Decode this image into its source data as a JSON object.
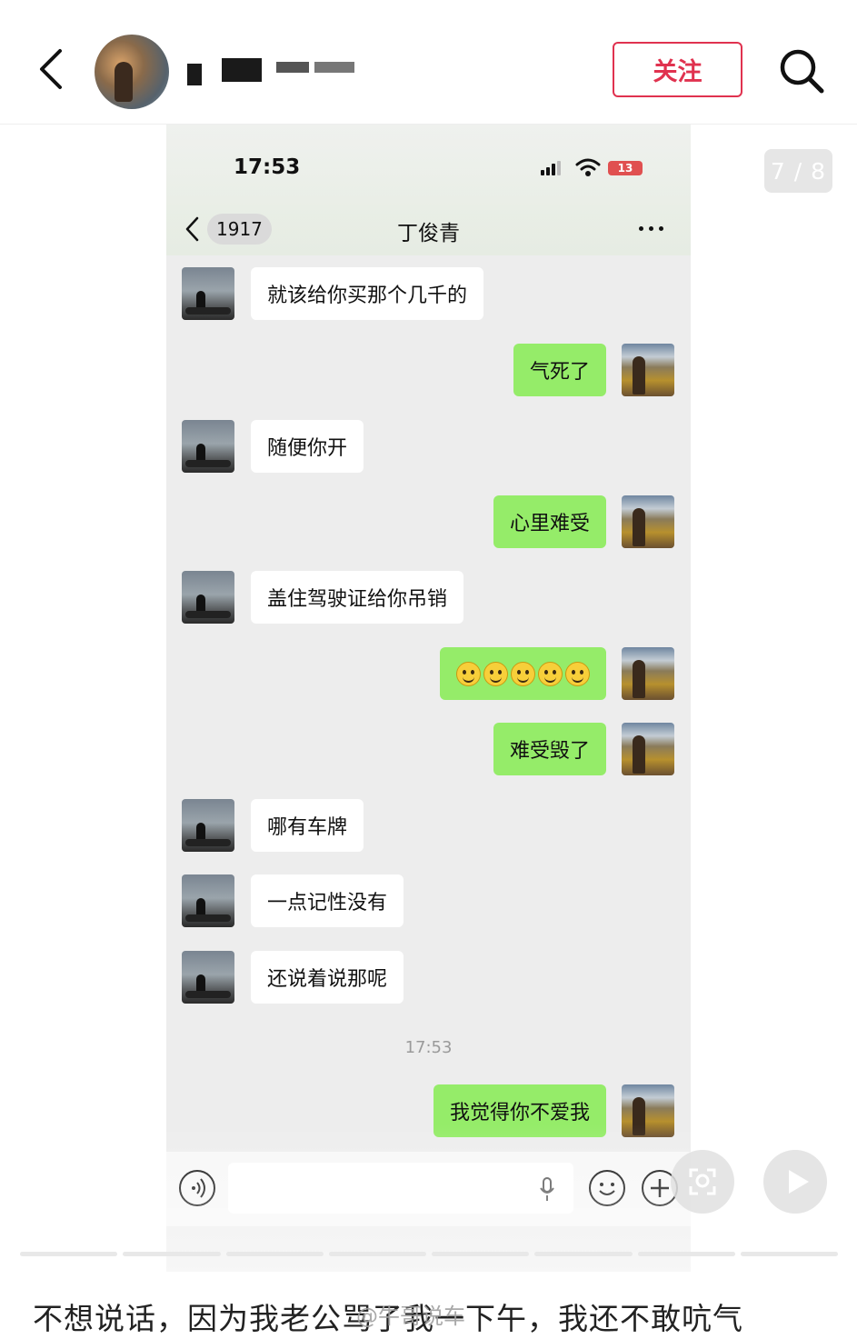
{
  "header": {
    "follow_label": "关注",
    "author_name": ""
  },
  "gallery": {
    "page_counter": "7 / 8",
    "page_current": 7,
    "page_total": 8
  },
  "phone": {
    "status": {
      "time": "17:53",
      "battery": "13"
    },
    "chat": {
      "unread_count": "1917",
      "contact_name": "丁俊青"
    },
    "messages": [
      {
        "from": "other",
        "text": "就该给你买那个几千的"
      },
      {
        "from": "me",
        "text": "气死了"
      },
      {
        "from": "other",
        "text": "随便你开"
      },
      {
        "from": "me",
        "text": "心里难受"
      },
      {
        "from": "other",
        "text": "盖住驾驶证给你吊销"
      },
      {
        "from": "me",
        "text": "",
        "emoji": "smiley-face",
        "emoji_count": 5
      },
      {
        "from": "me",
        "text": "难受毁了"
      },
      {
        "from": "other",
        "text": "哪有车牌"
      },
      {
        "from": "other",
        "text": "一点记性没有"
      },
      {
        "from": "other",
        "text": "还说着说那呢"
      },
      {
        "from": "me",
        "text": "我觉得你不爱我"
      }
    ],
    "timestamp": "17:53"
  },
  "caption": {
    "text": "不想说话，因为我老公骂了我一下午，我还不敢吭气",
    "watermark": "@牛哥说车"
  },
  "colors": {
    "follow": "#e0324f",
    "my_bubble": "#95ec69",
    "other_bubble": "#ffffff",
    "chat_bg": "#ededed"
  },
  "icons": [
    "back-arrow-icon",
    "search-icon",
    "chevron-left-icon",
    "more-dots-icon",
    "signal-icon",
    "wifi-icon",
    "battery-icon",
    "voice-icon",
    "mic-icon",
    "emoji-icon",
    "plus-icon",
    "scan-icon",
    "play-icon"
  ]
}
